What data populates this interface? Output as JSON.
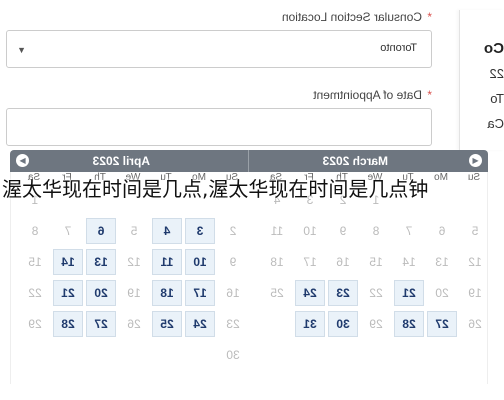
{
  "card": {
    "lines": [
      "Co",
      "22",
      "To",
      "Ca"
    ]
  },
  "form": {
    "location_label": "Consular Section Location",
    "required_mark": "*",
    "location_value": "Toronto",
    "date_label": "Date of Appointment",
    "date_value": ""
  },
  "calendar": {
    "nav_prev": "◀",
    "nav_next": "▶",
    "months": [
      {
        "title": "March 2023",
        "day_names": [
          "Su",
          "Mo",
          "Tu",
          "We",
          "Th",
          "Fr",
          "Sa"
        ],
        "weeks": [
          [
            "",
            "",
            "",
            "1",
            "2",
            "3",
            "4"
          ],
          [
            "5",
            "6",
            "7",
            "8",
            "9",
            "10",
            "11"
          ],
          [
            "12",
            "13",
            "14",
            "15",
            "16",
            "17",
            "18"
          ],
          [
            "19",
            "20",
            "21",
            "22",
            "23",
            "24",
            "25"
          ],
          [
            "26",
            "27",
            "28",
            "29",
            "30",
            "31",
            ""
          ]
        ],
        "available": [
          "21",
          "23",
          "24",
          "27",
          "28",
          "30",
          "31"
        ]
      },
      {
        "title": "April 2023",
        "day_names": [
          "Su",
          "Mo",
          "Tu",
          "We",
          "Th",
          "Fr",
          "Sa"
        ],
        "weeks": [
          [
            "",
            "",
            "",
            "",
            "",
            "",
            "1"
          ],
          [
            "2",
            "3",
            "4",
            "5",
            "6",
            "7",
            "8"
          ],
          [
            "9",
            "10",
            "11",
            "12",
            "13",
            "14",
            "15"
          ],
          [
            "16",
            "17",
            "18",
            "19",
            "20",
            "21",
            "22"
          ],
          [
            "23",
            "24",
            "25",
            "26",
            "27",
            "28",
            "29"
          ],
          [
            "30",
            "",
            "",
            "",
            "",
            "",
            ""
          ]
        ],
        "available": [
          "3",
          "4",
          "6",
          "10",
          "11",
          "13",
          "14",
          "17",
          "18",
          "20",
          "21",
          "24",
          "25",
          "27",
          "28"
        ]
      }
    ]
  },
  "overlay_text": "渥太华现在时间是几点,渥太华现在时间是几点钟"
}
